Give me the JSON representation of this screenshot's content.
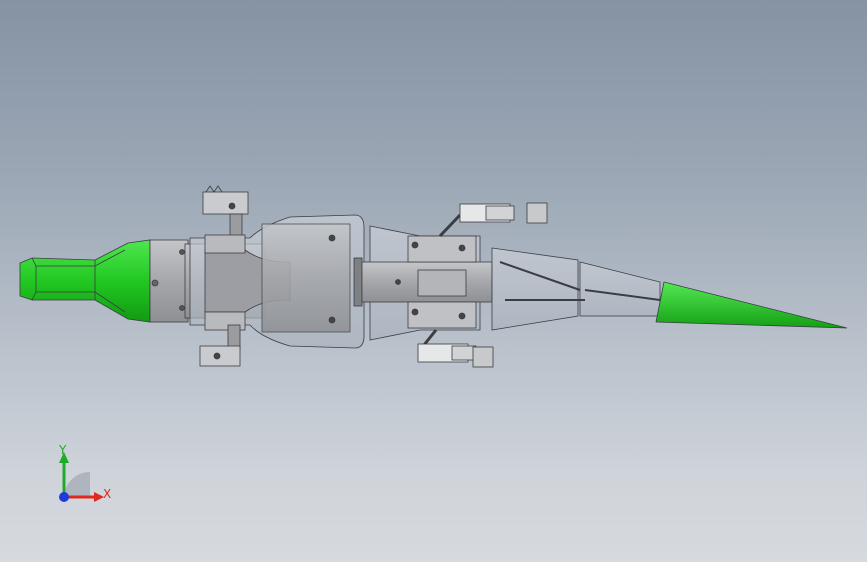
{
  "scene": {
    "description_colors": {
      "background_top": "#8693a3",
      "background_bottom": "#d6dadf",
      "head_green": "#2bd12b",
      "tail_green": "#22c822",
      "body_gray": "#a9aaad",
      "transparent_shell": "#b9c0c9",
      "outline": "#3a3d42"
    }
  },
  "triad": {
    "x_label": "X",
    "y_label": "Y",
    "x_color": "#e0281e",
    "y_color": "#1faa2a",
    "z_color": "#1e3ad8"
  }
}
